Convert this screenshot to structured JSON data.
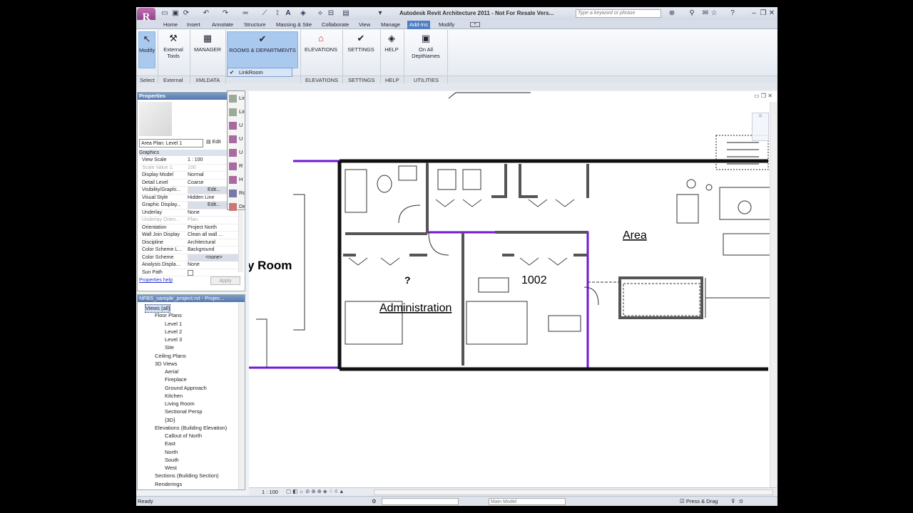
{
  "app": {
    "title": "Autodesk Revit Architecture 2011 - Not For Resale Vers...",
    "logo": "R",
    "search_placeholder": "Type a keyword or phrase"
  },
  "tabs": [
    "Home",
    "Insert",
    "Annotate",
    "Structure",
    "Massing & Site",
    "Collaborate",
    "View",
    "Manage",
    "Add-Ins",
    "Modify"
  ],
  "ribbon": {
    "buttons": {
      "modify": "Modify",
      "external_tools": "External Tools",
      "manager": "MANAGER",
      "rooms": "ROOMS & DEPARTMENTS",
      "elevations": "ELEVATIONS",
      "settings": "SETTINGS",
      "help": "HELP",
      "on_all": "On All DeptNames"
    },
    "panels": {
      "select": "Select",
      "external": "External",
      "xmldata": "XMLDATA",
      "elevations": "ELEVATIONS",
      "settings": "SETTINGS",
      "help": "HELP",
      "utilities": "UTILITIES"
    },
    "dropdown": "LinkRoom"
  },
  "flyout": [
    "Lin",
    "Lin",
    "U",
    "U",
    "U",
    "R",
    "H",
    "Ro",
    "De"
  ],
  "properties": {
    "title": "Properties",
    "type_selector": "Area Plan: Level 1",
    "edit_type": "Edit",
    "group": "Graphics",
    "rows": [
      {
        "k": "View Scale",
        "v": "1 : 100"
      },
      {
        "k": "Scale Value    1:",
        "v": "100"
      },
      {
        "k": "Display Model",
        "v": "Normal"
      },
      {
        "k": "Detail Level",
        "v": "Coarse"
      },
      {
        "k": "Visibility/Graphi...",
        "v": "Edit..."
      },
      {
        "k": "Visual Style",
        "v": "Hidden Line"
      },
      {
        "k": "Graphic Display...",
        "v": "Edit..."
      },
      {
        "k": "Underlay",
        "v": "None"
      },
      {
        "k": "Underlay Orien...",
        "v": "Plan"
      },
      {
        "k": "Orientation",
        "v": "Project North"
      },
      {
        "k": "Wall Join Display",
        "v": "Clean all wall ..."
      },
      {
        "k": "Discipline",
        "v": "Architectural"
      },
      {
        "k": "Color Scheme L...",
        "v": "Background"
      },
      {
        "k": "Color Scheme",
        "v": "<none>"
      },
      {
        "k": "Analysis Displa...",
        "v": "None"
      },
      {
        "k": "Sun Path",
        "v": ""
      }
    ],
    "help_link": "Properties help",
    "apply": "Apply"
  },
  "browser": {
    "title": "NFBS_sample_project.rvt - Projec...",
    "nodes": [
      "Views (all)",
      "Floor Plans",
      "Level 1",
      "Level 2",
      "Level 3",
      "Site",
      "Ceiling Plans",
      "3D Views",
      "Aerial",
      "Fireplace",
      "Ground Approach",
      "Kitchen",
      "Living Room",
      "Sectional Persp",
      "{3D}",
      "Elevations (Building Elevation)",
      "Callout of North",
      "East",
      "North",
      "South",
      "West",
      "Sections (Building Section)",
      "Renderings"
    ]
  },
  "plan": {
    "area_label": "Area",
    "room_number": "1002",
    "unknown_room": "?",
    "admin_label": "Administration",
    "room_fragment": "y Room"
  },
  "view_bar": {
    "scale": "1 : 100"
  },
  "status": {
    "text": "Ready",
    "model": "Main Model",
    "press_drag": "Press & Drag",
    "filter": ":0"
  }
}
